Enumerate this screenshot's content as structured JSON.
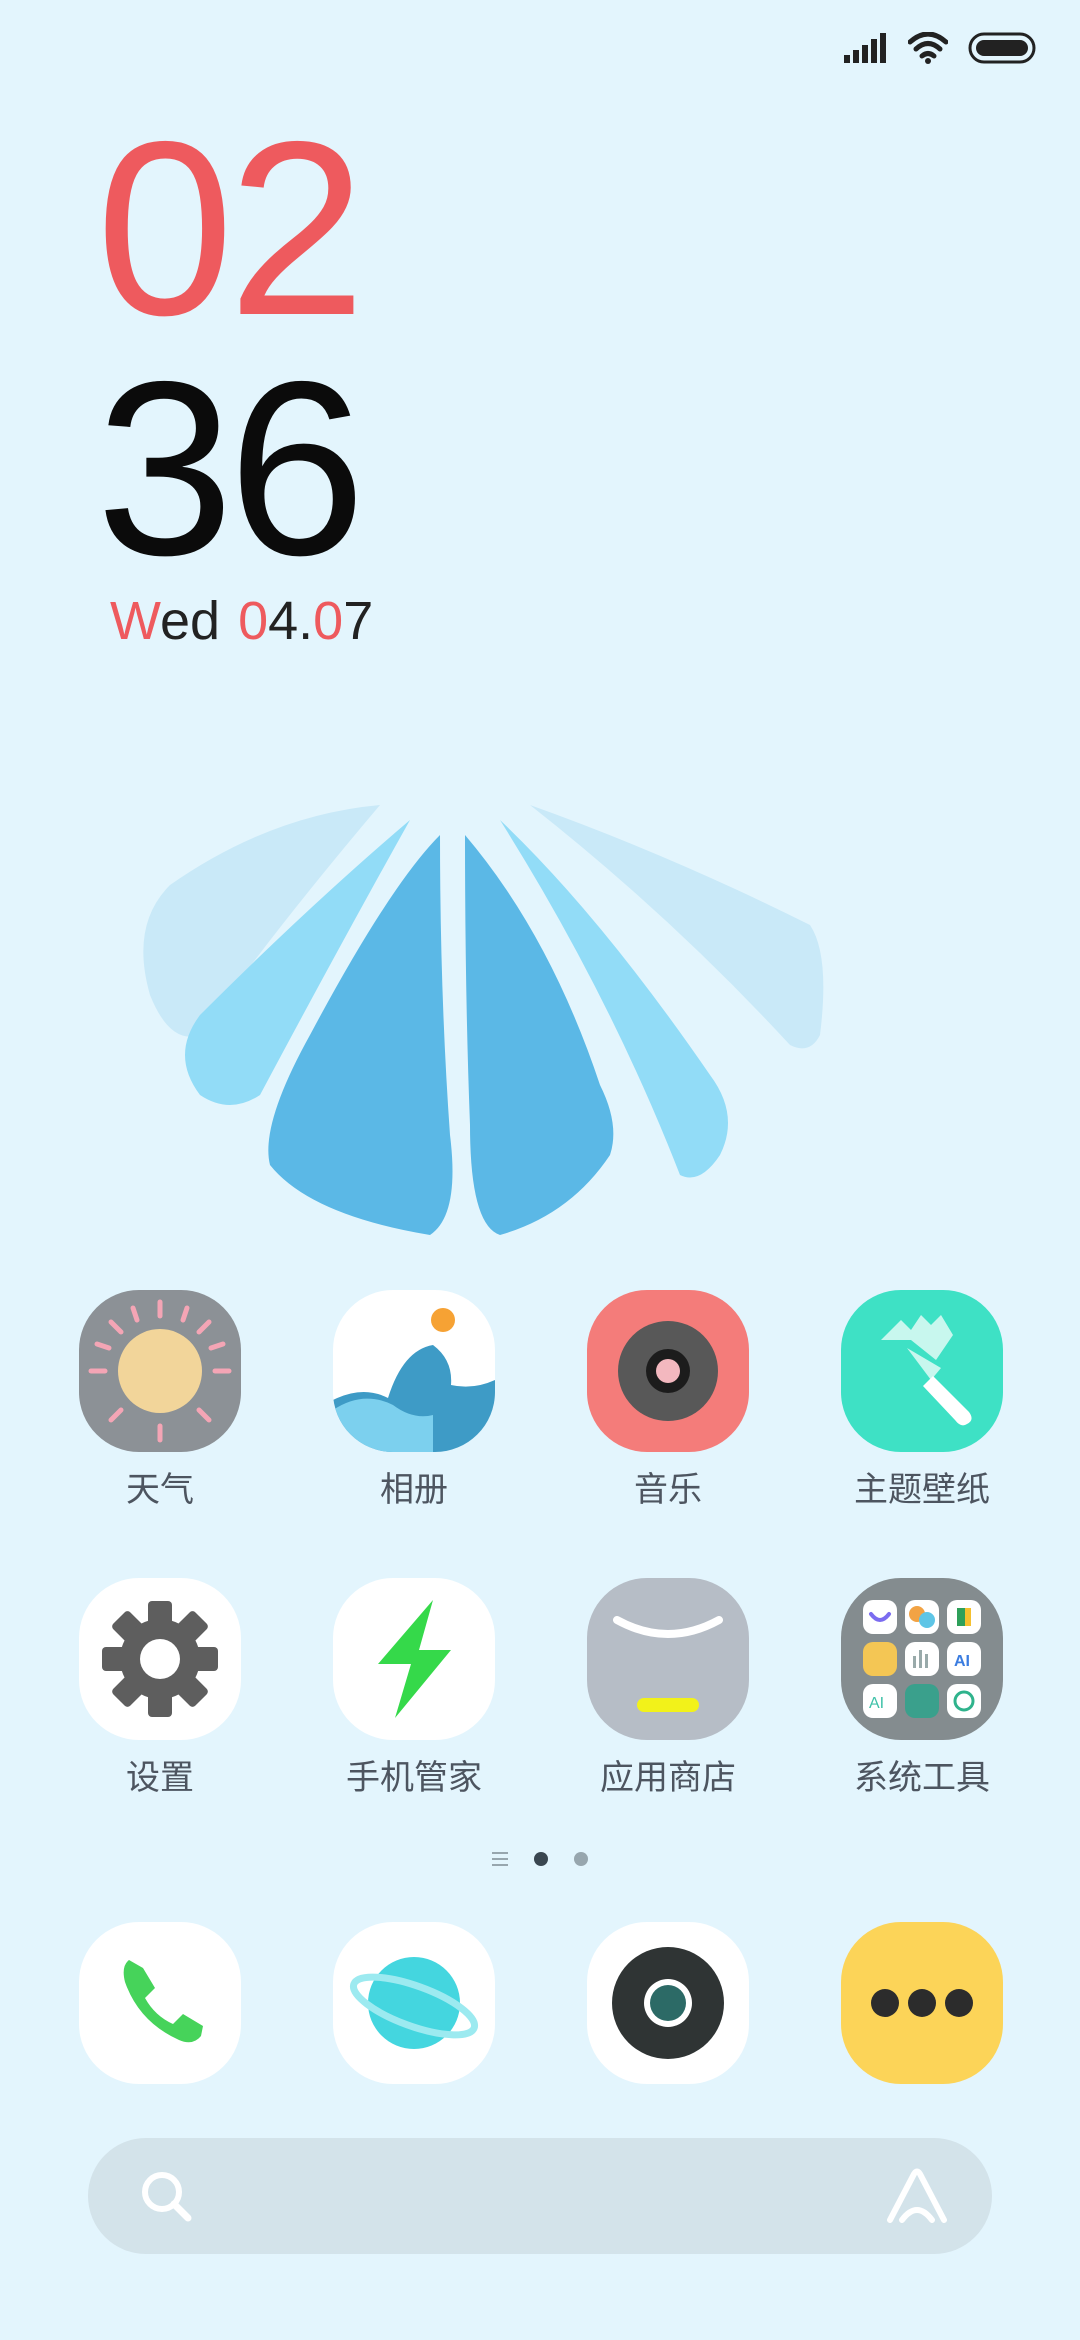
{
  "clock": {
    "hour": "02",
    "minute": "36"
  },
  "date": {
    "weekday_first": "W",
    "weekday_rest": "ed",
    "date_first": "0",
    "date_mid": "4.",
    "date_red": "0",
    "date_last": "7"
  },
  "apps_row1": [
    {
      "label": "天气",
      "icon": "weather-icon"
    },
    {
      "label": "相册",
      "icon": "gallery-icon"
    },
    {
      "label": "音乐",
      "icon": "music-icon"
    },
    {
      "label": "主题壁纸",
      "icon": "themes-icon"
    }
  ],
  "apps_row2": [
    {
      "label": "设置",
      "icon": "settings-icon"
    },
    {
      "label": "手机管家",
      "icon": "security-icon"
    },
    {
      "label": "应用商店",
      "icon": "app-store-icon"
    },
    {
      "label": "系统工具",
      "icon": "tools-folder-icon"
    }
  ],
  "dock": [
    {
      "icon": "phone-icon"
    },
    {
      "icon": "browser-icon"
    },
    {
      "icon": "camera-icon"
    },
    {
      "icon": "messages-icon"
    }
  ],
  "colors": {
    "background": "#e3f5fd",
    "clock_red": "#ee5a5e"
  }
}
